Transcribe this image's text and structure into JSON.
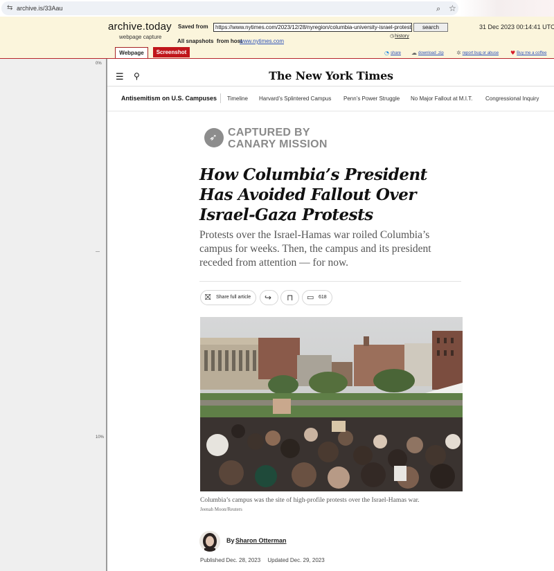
{
  "browser": {
    "url": "archive.is/33Aau"
  },
  "archive": {
    "logo": "archive.today",
    "subtitle": "webpage capture",
    "saved_from_label": "Saved from",
    "saved_url": "https://www.nytimes.com/2023/12/28/nyregion/columbia-university-israel-protests",
    "search_label": "search",
    "history_label": "history",
    "timestamp": "31 Dec 2023 00:14:41 UTC",
    "all_snapshots_label": "All snapshots",
    "from_host_label": "from host",
    "host": "www.nytimes.com",
    "tabs": {
      "webpage": "Webpage",
      "screenshot": "Screenshot"
    },
    "tools": {
      "share": "share",
      "download": "download .zip",
      "report": "report bug or abuse",
      "coffee": "Buy me a coffee"
    },
    "gutter_marks": {
      "top": "0%",
      "mid": "—",
      "ten": "10%"
    }
  },
  "nyt": {
    "masthead": "The New York Times",
    "subnav": {
      "title": "Antisemitism on U.S. Campuses",
      "items": [
        "Timeline",
        "Harvard’s Splintered Campus",
        "Penn’s Power Struggle",
        "No Major Fallout at M.I.T.",
        "Congressional Inquiry"
      ]
    },
    "captured": {
      "line1": "CAPTURED BY",
      "line2": "CANARY MISSION"
    },
    "headline": "How Columbia’s President Has Avoided Fallout Over Israel-Gaza Protests",
    "summary": "Protests over the Israel-Hamas war roiled Columbia’s campus for weeks. Then, the campus and its president receded from attention — for now.",
    "share_label": "Share full article",
    "comment_count": "618",
    "caption": "Columbia’s campus was the site of high-profile protests over the Israel-Hamas war.",
    "credit": "Jeenah Moon/Reuters",
    "byline_prefix": "By",
    "author": "Sharon Otterman",
    "published": "Published Dec. 28, 2023",
    "updated": "Updated Dec. 29, 2023"
  },
  "icons": {
    "lock": "site-info-icon",
    "zoom": "zoom-icon",
    "star": "bookmark-star-icon",
    "menu": "hamburger-menu-icon",
    "search": "search-icon",
    "gift": "gift-icon",
    "forward": "share-arrow-icon",
    "bookmark": "bookmark-icon",
    "comment": "comment-icon"
  },
  "colors": {
    "archive_bg": "#fbf5dc",
    "archive_red": "#c0161b",
    "link_blue": "#2a4fb8"
  }
}
